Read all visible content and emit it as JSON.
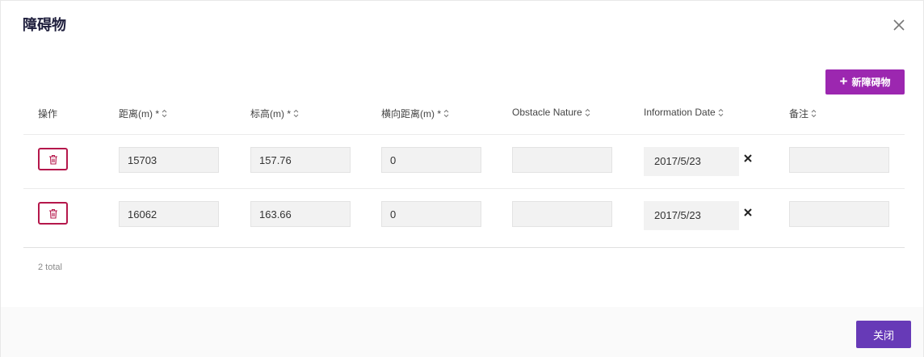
{
  "dialog": {
    "title": "障碍物",
    "add_label": "新障碍物",
    "close_label": "关闭",
    "total": "2 total"
  },
  "columns": {
    "action": "操作",
    "distance": "距离(m) *",
    "elevation": "标高(m) *",
    "lateral": "横向距离(m) *",
    "nature": "Obstacle Nature",
    "date": "Information Date",
    "remark": "备注"
  },
  "rows": [
    {
      "distance": "15703",
      "elevation": "157.76",
      "lateral": "0",
      "nature": "",
      "date": "2017/5/23",
      "remark": ""
    },
    {
      "distance": "16062",
      "elevation": "163.66",
      "lateral": "0",
      "nature": "",
      "date": "2017/5/23",
      "remark": ""
    }
  ],
  "icons": {
    "close": "close-icon",
    "add": "plus-icon",
    "delete": "trash-icon",
    "sort": "sort-icon",
    "clear": "clear-icon"
  },
  "colors": {
    "primary": "#673ab7",
    "accent": "#9c27b0",
    "danger": "#b5174b"
  }
}
